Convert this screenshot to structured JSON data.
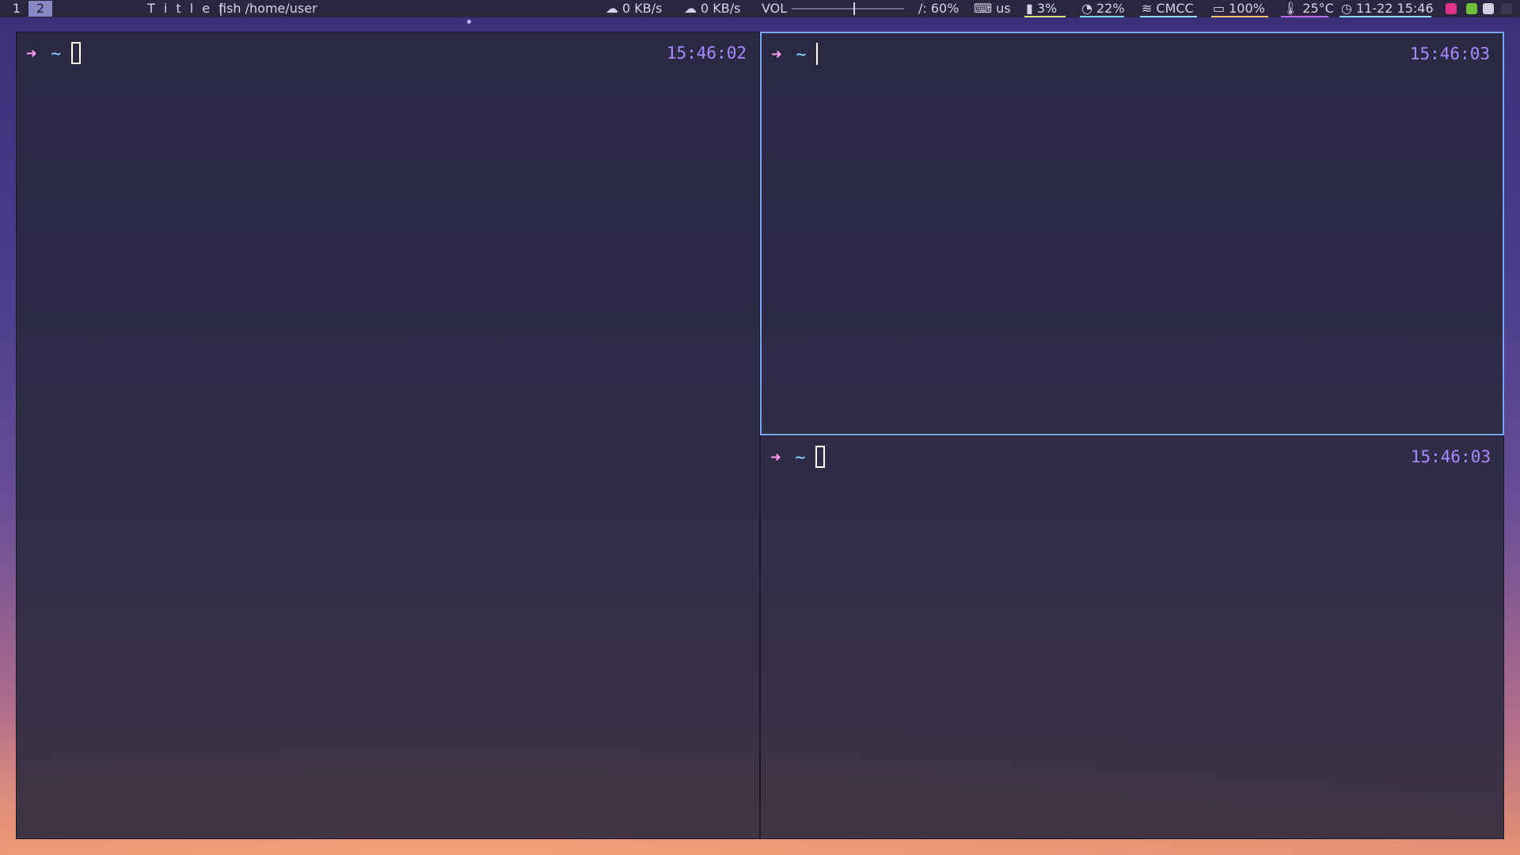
{
  "topbar": {
    "workspaces": [
      "1",
      "2"
    ],
    "active_workspace": "2",
    "title_label": "T i t l e |",
    "window_title": "fish /home/user",
    "upload": "0 KB/s",
    "download": "0 KB/s",
    "volume_label": "VOL",
    "volume_level": 0.55,
    "disk": "/: 60%",
    "keyboard": "us",
    "memory": "3%",
    "cpu": "22%",
    "wifi": "CMCC",
    "battery": "100%",
    "temperature": "25°C",
    "datetime": "11-22 15:46"
  },
  "terminals": [
    {
      "id": "left",
      "time": "15:46:02",
      "arrow": "➜",
      "cwd": "~",
      "focused": false
    },
    {
      "id": "top-right",
      "time": "15:46:03",
      "arrow": "➜",
      "cwd": "~",
      "focused": true
    },
    {
      "id": "bottom-right",
      "time": "15:46:03",
      "arrow": "➜",
      "cwd": "~",
      "focused": false
    }
  ],
  "colors": {
    "bar_bg": "#2b2640",
    "accent_focus": "#7aa2f7",
    "prompt_arrow": "#ff9ff3",
    "prompt_cwd": "#89ddff",
    "time": "#a98bff"
  }
}
